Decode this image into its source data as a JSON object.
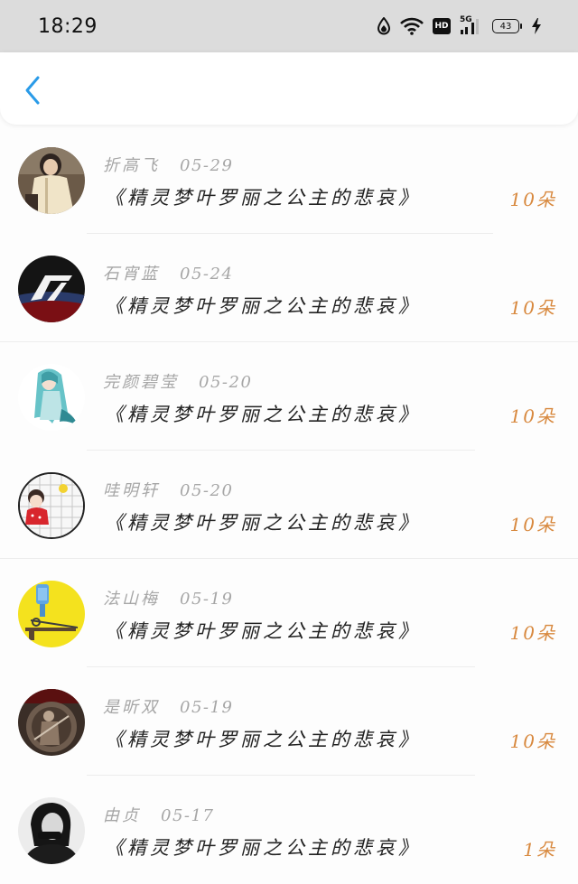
{
  "status_bar": {
    "time": "18:29",
    "network_badge": "HD",
    "cellular_label": "5G",
    "battery_level": "43"
  },
  "header": {
    "back_icon": "chevron-left-icon",
    "accent_color": "#2a9be8"
  },
  "gift_records": [
    {
      "name": "折高飞",
      "date": "05-29",
      "gift": "《精灵梦叶罗丽之公主的悲哀》",
      "count": "10朵",
      "avatar": "photo-avatar-girl-coat"
    },
    {
      "name": "石宵蓝",
      "date": "05-24",
      "gift": "《精灵梦叶罗丽之公主的悲哀》",
      "count": "10朵",
      "avatar": "logo-avatar-dark"
    },
    {
      "name": "完颜碧莹",
      "date": "05-20",
      "gift": "《精灵梦叶罗丽之公主的悲哀》",
      "count": "10朵",
      "avatar": "anime-avatar-teal"
    },
    {
      "name": "哇明轩",
      "date": "05-20",
      "gift": "《精灵梦叶罗丽之公主的悲哀》",
      "count": "10朵",
      "avatar": "cartoon-avatar-chess"
    },
    {
      "name": "法山梅",
      "date": "05-19",
      "gift": "《精灵梦叶罗丽之公主的悲哀》",
      "count": "10朵",
      "avatar": "illustration-avatar-yellow"
    },
    {
      "name": "是昕双",
      "date": "05-19",
      "gift": "《精灵梦叶罗丽之公主的悲哀》",
      "count": "10朵",
      "avatar": "photo-avatar-sepia"
    },
    {
      "name": "由贞",
      "date": "05-17",
      "gift": "《精灵梦叶罗丽之公主的悲哀》",
      "count": "1朵",
      "avatar": "photo-avatar-bw"
    }
  ],
  "colors": {
    "count": "#d8893f",
    "meta": "#a6a6a6",
    "title": "#222222"
  }
}
